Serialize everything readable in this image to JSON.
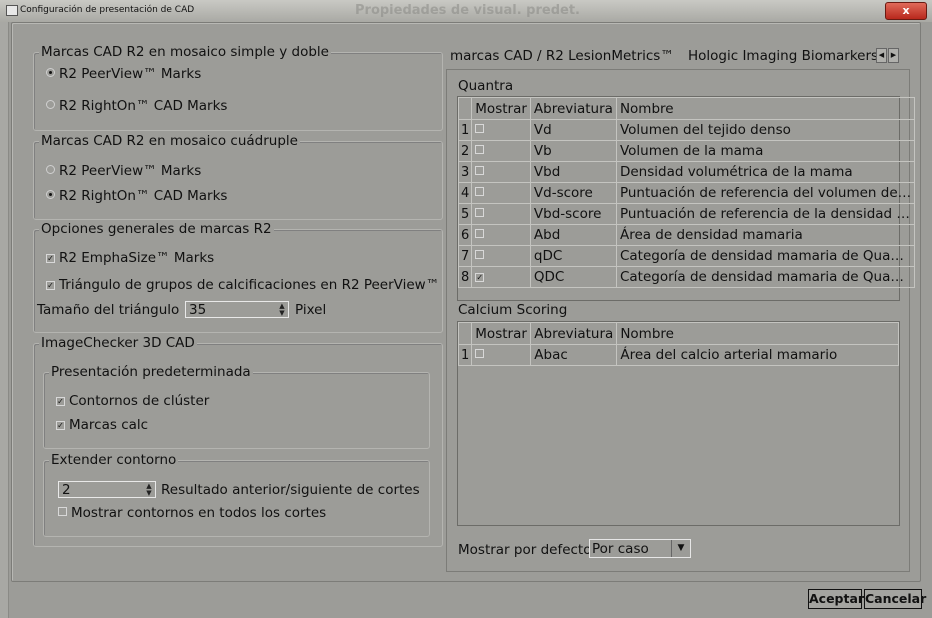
{
  "window": {
    "title": "Configuración de presentación de CAD",
    "behind_title": "Propiedades de visual. predet.",
    "close_label": "x"
  },
  "left": {
    "group1": {
      "title": "Marcas CAD R2 en mosaico simple y doble",
      "opt1": "R2 PeerView™ Marks",
      "opt2": "R2 RightOn™ CAD Marks",
      "selected": 1
    },
    "group2": {
      "title": "Marcas CAD R2 en mosaico cuádruple",
      "opt1": "R2 PeerView™ Marks",
      "opt2": "R2 RightOn™ CAD Marks",
      "selected": 2
    },
    "group3": {
      "title": "Opciones generales de marcas R2",
      "check1": "R2 EmphaSize™ Marks",
      "check1_checked": true,
      "check2": "Triángulo de grupos de calcificaciones en R2 PeerView™",
      "check2_checked": true,
      "size_label": "Tamaño del triángulo",
      "size_value": "35",
      "size_unit": "Pixel"
    },
    "group4": {
      "title": "ImageChecker 3D CAD",
      "sub1_title": "Presentación predeterminada",
      "sub1_check1": "Contornos de clúster",
      "sub1_check1_checked": true,
      "sub1_check2": "Marcas calc",
      "sub1_check2_checked": true,
      "sub2_title": "Extender contorno",
      "extend_value": "2",
      "extend_label": "Resultado anterior/siguiente de cortes",
      "show_all_label": "Mostrar contornos en todos los cortes",
      "show_all_checked": false
    }
  },
  "tabs": [
    {
      "label": "marcas CAD / R2 LesionMetrics™"
    },
    {
      "label": "Hologic Imaging Biomarkers"
    }
  ],
  "tab_scroll_left": "◀",
  "tab_scroll_right": "▶",
  "quantra": {
    "title": "Quantra",
    "headers": [
      "Mostrar",
      "Abreviatura",
      "Nombre"
    ],
    "rows": [
      {
        "n": "1",
        "checked": false,
        "abbr": "Vd",
        "name": "Volumen del tejido denso"
      },
      {
        "n": "2",
        "checked": false,
        "abbr": "Vb",
        "name": "Volumen de la mama"
      },
      {
        "n": "3",
        "checked": false,
        "abbr": "Vbd",
        "name": "Densidad volumétrica de la mama"
      },
      {
        "n": "4",
        "checked": false,
        "abbr": "Vd-score",
        "name": "Puntuación de referencia del volumen de…"
      },
      {
        "n": "5",
        "checked": false,
        "abbr": "Vbd-score",
        "name": "Puntuación de referencia de la densidad …"
      },
      {
        "n": "6",
        "checked": false,
        "abbr": "Abd",
        "name": "Área de densidad mamaria"
      },
      {
        "n": "7",
        "checked": false,
        "abbr": "qDC",
        "name": "Categoría de densidad mamaria de Qua…"
      },
      {
        "n": "8",
        "checked": true,
        "abbr": "QDC",
        "name": "Categoría de densidad mamaria de Qua…"
      }
    ]
  },
  "calcium": {
    "title": "Calcium Scoring",
    "headers": [
      "Mostrar",
      "Abreviatura",
      "Nombre"
    ],
    "rows": [
      {
        "n": "1",
        "checked": false,
        "abbr": "Abac",
        "name": "Área del calcio arterial mamario"
      }
    ]
  },
  "default_display": {
    "label": "Mostrar por defecto:",
    "value": "Por caso",
    "arrow": "▼"
  },
  "buttons": {
    "accept": "Aceptar",
    "cancel": "Cancelar"
  },
  "glyphs": {
    "check_on": "✓",
    "spin_up": "▲",
    "spin_down": "▼"
  }
}
